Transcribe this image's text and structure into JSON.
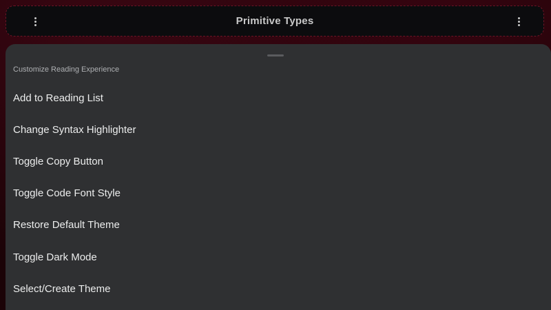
{
  "app_bar": {
    "title": "Primitive Types",
    "left_icon": "more-vert-icon",
    "right_icon": "more-vert-icon"
  },
  "sheet": {
    "title": "Customize Reading Experience",
    "items": [
      {
        "label": "Add to Reading List"
      },
      {
        "label": "Change Syntax Highlighter"
      },
      {
        "label": "Toggle Copy Button"
      },
      {
        "label": "Toggle Code Font Style"
      },
      {
        "label": "Restore Default Theme"
      },
      {
        "label": "Toggle Dark Mode"
      },
      {
        "label": "Select/Create Theme"
      }
    ]
  },
  "colors": {
    "background": "#1b0307",
    "app_bar": "#0c0c0e",
    "app_bar_border": "#6e1426",
    "sheet": "#2f3032",
    "text": "#eceded",
    "muted_text": "#aeb0b3"
  }
}
